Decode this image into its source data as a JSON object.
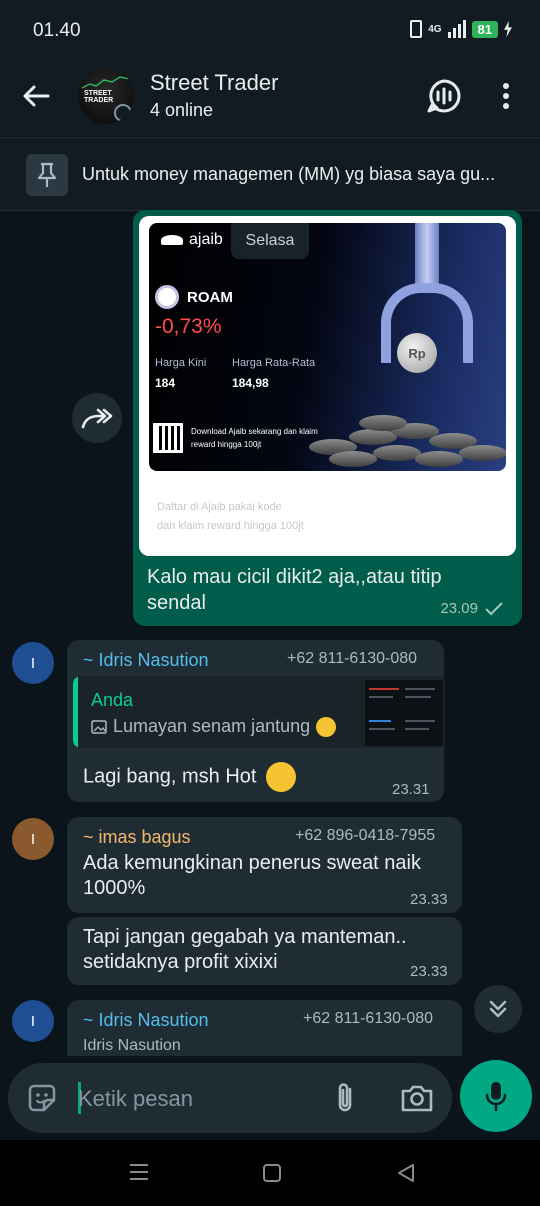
{
  "status_bar": {
    "time": "01.40",
    "network": "4G",
    "battery": "81"
  },
  "header": {
    "title": "Street Trader",
    "subtitle": "4 online",
    "avatar_text": "STREET TRADER"
  },
  "pinned": {
    "text": "Untuk money managemen (MM) yg biasa saya gu..."
  },
  "date_chip": "Selasa",
  "outgoing_image_message": {
    "brand": "ajaib",
    "ticker": "ROAM",
    "change": "-0,73%",
    "price_now_label": "Harga Kini",
    "price_now": "184",
    "price_avg_label": "Harga Rata-Rata",
    "price_avg": "184,98",
    "download_text": "Download Ajaib sekarang dan klaim reward hingga 100jt",
    "coin_label": "Rp",
    "caption_line1": "Daftar di Ajaib pakai kode",
    "caption_line2": "dan klaim reward hingga 100jt",
    "text": "Kalo mau cicil dikit2 aja,,atau titip sendal",
    "time": "23.09"
  },
  "messages": [
    {
      "avatar": "I",
      "sender": "~ Idris Nasution",
      "phone": "+62 811-6130-080",
      "quote_author": "Anda",
      "quote_text": "Lumayan senam jantung",
      "text": "Lagi bang, msh Hot",
      "time": "23.31"
    },
    {
      "avatar": "I",
      "sender": "~ imas bagus",
      "phone": "+62 896-0418-7955",
      "text": "Ada kemungkinan penerus sweat naik 1000%",
      "time": "23.33"
    },
    {
      "text": "Tapi jangan gegabah ya manteman.. setidaknya profit xixixi",
      "time": "23.33"
    },
    {
      "avatar": "I",
      "sender": "~ Idris Nasution",
      "phone": "+62 811-6130-080",
      "text": "Idris Nasution"
    }
  ],
  "input": {
    "placeholder": "Ketik pesan"
  },
  "colors": {
    "accent": "#00a884",
    "outgoing_bubble": "#005c4b",
    "incoming_bubble": "#202c33",
    "sender_blue": "#53bdeb",
    "sender_orange": "#f4b76b"
  }
}
